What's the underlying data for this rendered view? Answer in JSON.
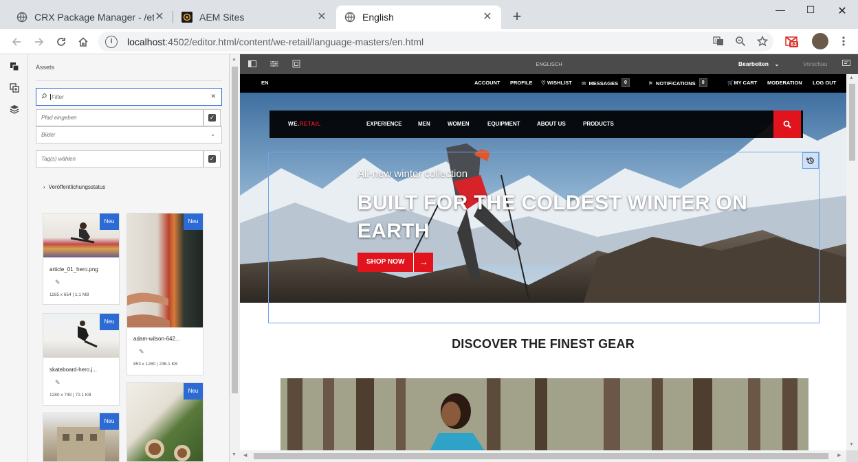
{
  "browser": {
    "tabs": [
      {
        "title": "CRX Package Manager - /etc/pac",
        "icon": "globe-icon",
        "active": false
      },
      {
        "title": "AEM Sites",
        "icon": "aem-logo-icon",
        "active": false
      },
      {
        "title": "English",
        "icon": "globe-icon",
        "active": true
      }
    ],
    "url_host": "localhost",
    "url_rest": ":4502/editor.html/content/we-retail/language-masters/en.html",
    "gmail_badge": "63"
  },
  "panel": {
    "title": "Assets",
    "filter_placeholder": "Filter",
    "path_placeholder": "Pfad eingeben",
    "type_select": "Bilder",
    "tags_placeholder": "Tag(s) wählen",
    "publish_status": "Veröffentlichungsstatus",
    "new_badge": "Neu",
    "assets": [
      {
        "name": "article_01_hero.png",
        "meta": "1165 x 654 | 1.1 MB"
      },
      {
        "name": "adam-wilson-642...",
        "meta": "853 x 1280 | 236.1 KB"
      },
      {
        "name": "skateboard-hero.j...",
        "meta": "1280 x 749 | 72.1 KB"
      },
      {
        "name": "",
        "meta": ""
      },
      {
        "name": "",
        "meta": ""
      }
    ]
  },
  "editor": {
    "language": "ENGLISCH",
    "mode_label": "Bearbeiten",
    "preview_label": "Vorschau"
  },
  "site": {
    "lang": "EN",
    "top_links": {
      "account": "ACCOUNT",
      "profile": "PROFILE",
      "wishlist": "WISHLIST",
      "messages": "MESSAGES",
      "messages_count": "0",
      "notifications": "NOTIFICATIONS",
      "notifications_count": "0",
      "cart": "MY CART",
      "moderation": "MODERATION",
      "logout": "LOG OUT"
    },
    "logo_a": "WE.",
    "logo_b": "RETAIL",
    "nav": [
      "EXPERIENCE",
      "MEN",
      "WOMEN",
      "EQUIPMENT",
      "ABOUT US",
      "PRODUCTS"
    ],
    "hero_kicker": "All-new winter collection",
    "hero_title": "BUILT FOR THE COLDEST WINTER ON EARTH",
    "cta": "SHOP NOW",
    "section_title": "DISCOVER THE FINEST GEAR"
  },
  "colors": {
    "brand_red": "#e1141e",
    "aem_blue": "#2d6bd4",
    "editbar": "#4b4b4b"
  }
}
